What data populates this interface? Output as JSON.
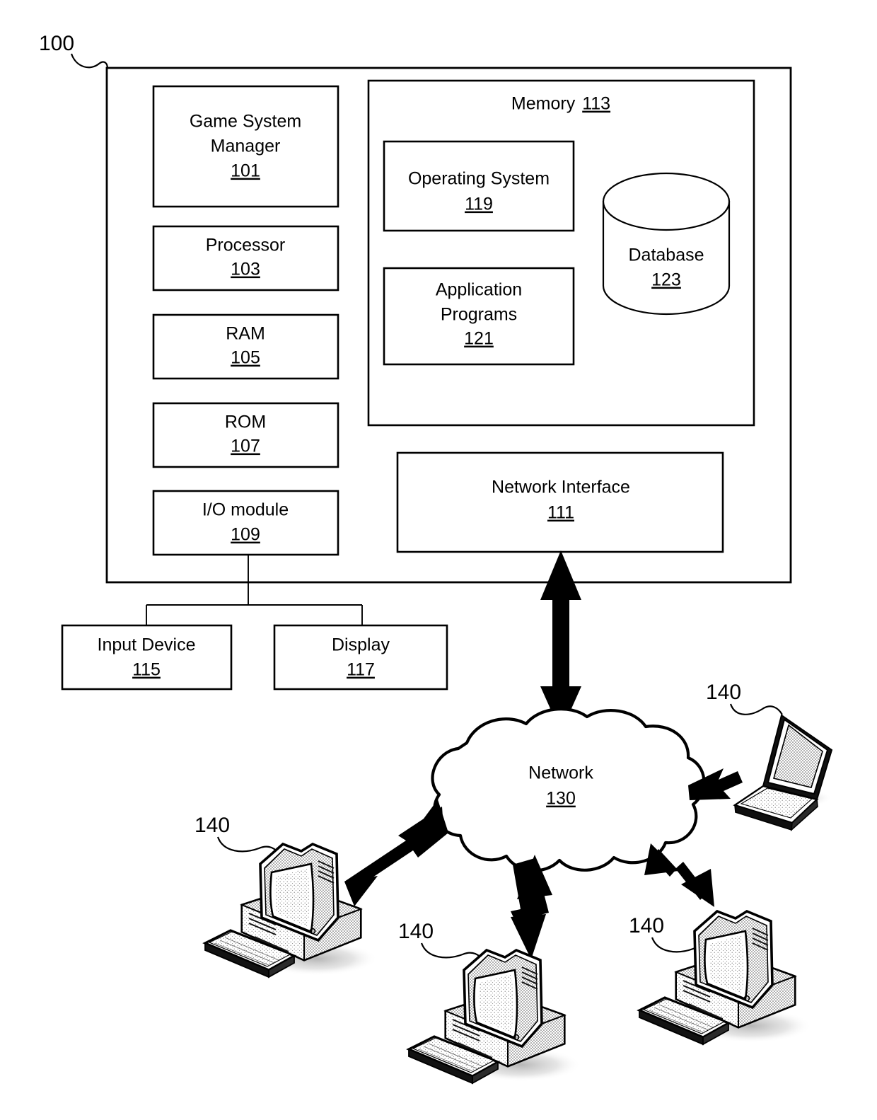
{
  "figure": {
    "system_ref": "100",
    "outer_label": "100"
  },
  "system_block": {
    "components": [
      {
        "label": "Game System Manager",
        "line1": "Game System",
        "line2": "Manager",
        "ref": "101"
      },
      {
        "label": "Processor",
        "line1": "Processor",
        "line2": "",
        "ref": "103"
      },
      {
        "label": "RAM",
        "line1": "RAM",
        "line2": "",
        "ref": "105"
      },
      {
        "label": "ROM",
        "line1": "ROM",
        "line2": "",
        "ref": "107"
      },
      {
        "label": "I/O module",
        "line1": "I/O module",
        "line2": "",
        "ref": "109"
      }
    ]
  },
  "memory": {
    "title": "Memory",
    "ref": "113",
    "items": [
      {
        "line1": "Operating System",
        "line2": "",
        "ref": "119"
      },
      {
        "line1": "Application",
        "line2": "Programs",
        "ref": "121"
      }
    ],
    "database": {
      "label": "Database",
      "ref": "123"
    }
  },
  "network_interface": {
    "label": "Network Interface",
    "ref": "111"
  },
  "peripherals": [
    {
      "label": "Input Device",
      "ref": "115"
    },
    {
      "label": "Display",
      "ref": "117"
    }
  ],
  "network": {
    "label": "Network",
    "ref": "130"
  },
  "terminals": [
    {
      "kind": "laptop",
      "ref": "140"
    },
    {
      "kind": "desktop",
      "ref": "140"
    },
    {
      "kind": "desktop",
      "ref": "140"
    },
    {
      "kind": "desktop",
      "ref": "140"
    }
  ],
  "colors": {
    "stroke": "#000000",
    "background": "#ffffff",
    "shade_light": "#e3e3e3",
    "shade_mid": "#c9c9c9",
    "shade_dark": "#9b9b9b"
  }
}
